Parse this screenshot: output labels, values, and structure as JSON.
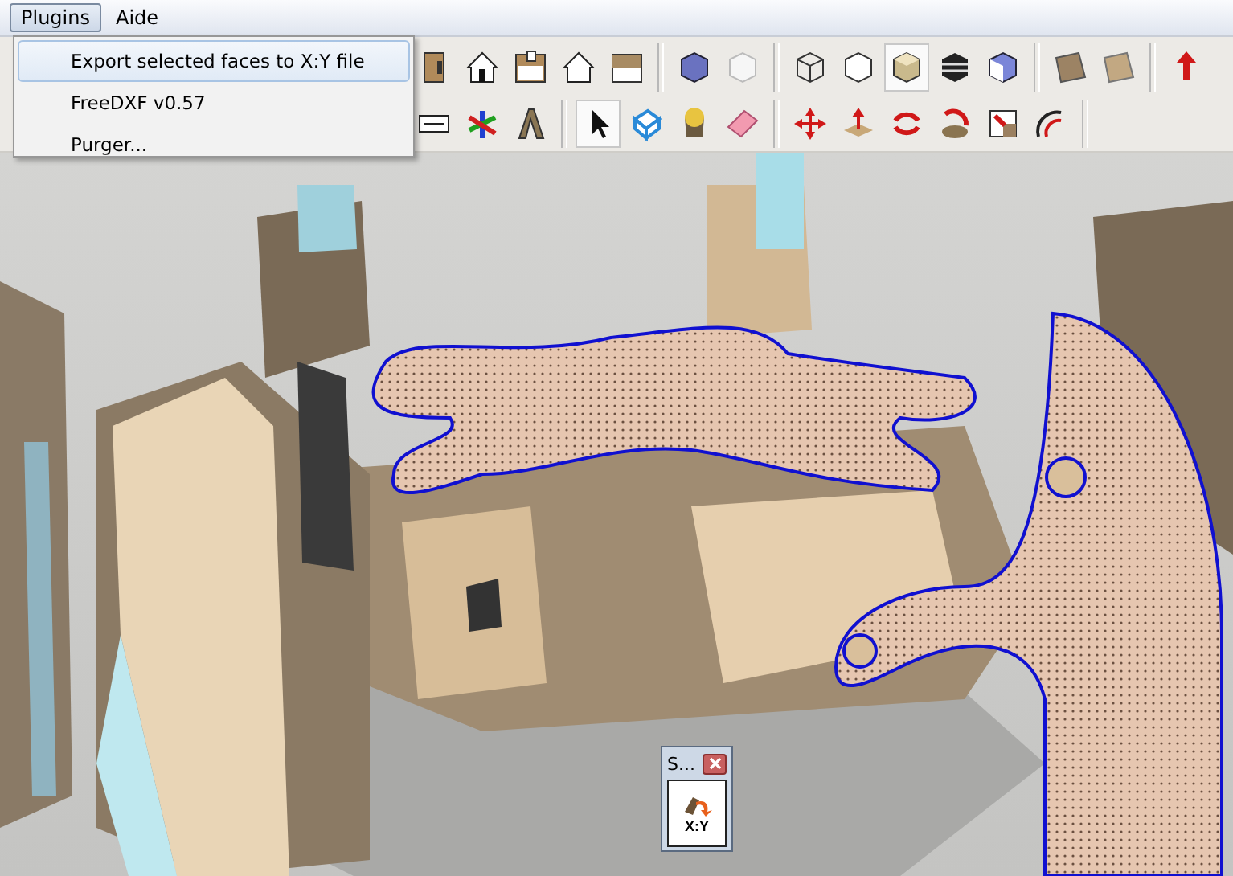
{
  "menu_bar": {
    "items": [
      {
        "label": "Plugins",
        "selected": true
      },
      {
        "label": "Aide",
        "selected": false
      }
    ]
  },
  "dropdown_menu": {
    "items": [
      {
        "label": "Export selected faces to X:Y file",
        "selected": true
      },
      {
        "label": "FreeDXF v0.57",
        "selected": false
      },
      {
        "label": "Purger...",
        "selected": false
      }
    ]
  },
  "floating_toolbar": {
    "title": "S...",
    "tool_label": "X:Y"
  }
}
